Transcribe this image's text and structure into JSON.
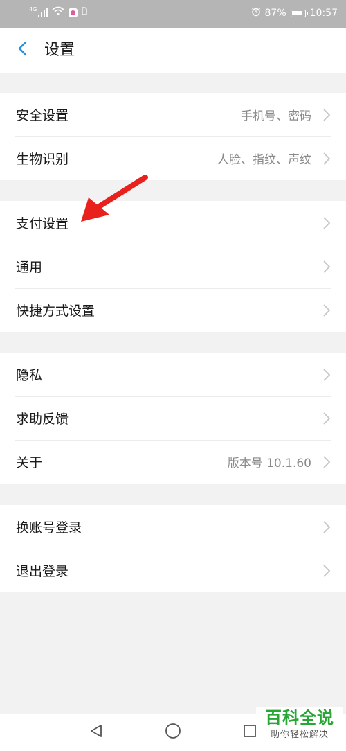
{
  "status_bar": {
    "network_label": "4G",
    "battery_percent": "87%",
    "time": "10:57"
  },
  "header": {
    "title": "设置"
  },
  "groups": [
    {
      "items": [
        {
          "label": "安全设置",
          "value": "手机号、密码"
        },
        {
          "label": "生物识别",
          "value": "人脸、指纹、声纹"
        }
      ]
    },
    {
      "items": [
        {
          "label": "支付设置",
          "value": ""
        },
        {
          "label": "通用",
          "value": ""
        },
        {
          "label": "快捷方式设置",
          "value": ""
        }
      ]
    },
    {
      "items": [
        {
          "label": "隐私",
          "value": ""
        },
        {
          "label": "求助反馈",
          "value": ""
        },
        {
          "label": "关于",
          "value": "版本号 10.1.60"
        }
      ]
    },
    {
      "items": [
        {
          "label": "换账号登录",
          "value": ""
        },
        {
          "label": "退出登录",
          "value": ""
        }
      ]
    }
  ],
  "watermark": {
    "title": "百科全说",
    "subtitle": "助你轻松解决"
  },
  "colors": {
    "accent": "#2b8fd6",
    "annotation": "#e8211d",
    "status_bar": "#b5b5b5",
    "watermark": "#27a635"
  },
  "icons": {
    "back": "chevron-left-icon",
    "row": "chevron-right-icon",
    "annotation": "red-arrow-icon",
    "nav": [
      "nav-back-icon",
      "nav-home-icon",
      "nav-recents-icon"
    ]
  }
}
